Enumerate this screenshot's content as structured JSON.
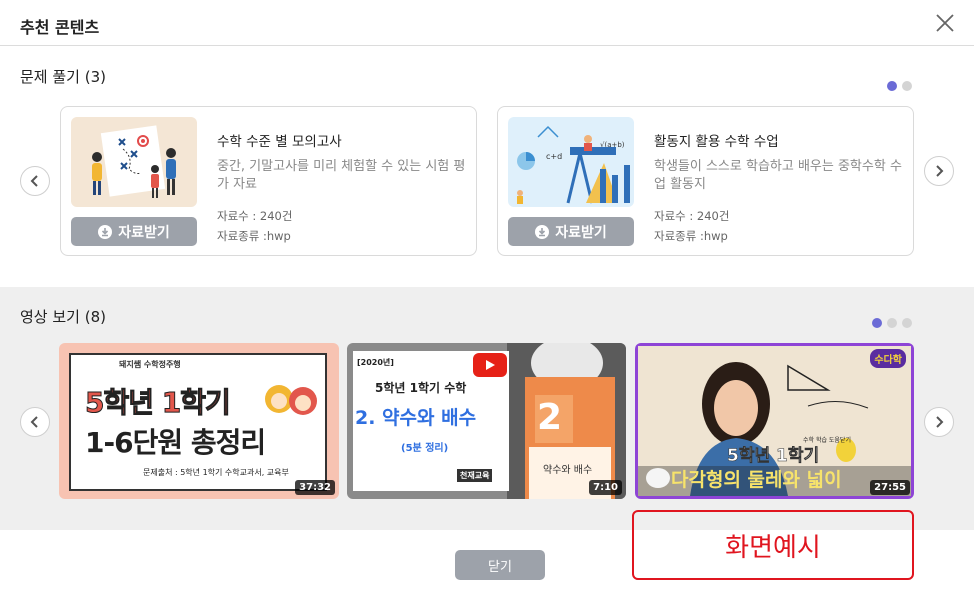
{
  "dialog": {
    "title": "추천 콘텐츠"
  },
  "problems": {
    "heading": "문제 풀기 (3)",
    "cards": [
      {
        "title": "수학 수준 별 모의고사",
        "desc": "중간, 기말고사를 미리 체험할 수 있는 시험 평가 자료",
        "count": "자료수 : 240건",
        "type": "자료종류 :hwp",
        "button": "자료받기"
      },
      {
        "title": "활동지 활용 수학 수업",
        "desc": "학생들이 스스로 학습하고 배우는 중학수학 수업 활동지",
        "count": "자료수 : 240건",
        "type": "자료종류 :hwp",
        "button": "자료받기"
      }
    ]
  },
  "videos": {
    "heading": "영상 보기 (8)",
    "items": [
      {
        "tag": "돼지쌤 수학정주행",
        "line1": "5학년 1학기",
        "line2": "1-6단원 총정리",
        "source": "문제출처 : 5학년 1학기 수학교과서, 교육부",
        "duration": "37:32"
      },
      {
        "tag": "[2020년]",
        "line1": "5학년 1학기 수학",
        "line2": "2. 약수와 배수",
        "line3": "(5분 정리)",
        "badge": "천재교육",
        "book_num": "2",
        "book_title": "약수와 배수",
        "duration": "7:10"
      },
      {
        "logo": "수다학",
        "caption_small": "수학 학습 도움닫기",
        "line1": "5학년 1학기",
        "line2": "다각형의 둘레와 넓이",
        "duration": "27:55"
      }
    ]
  },
  "footer": {
    "close": "닫기"
  },
  "annotation": {
    "label": "화면예시"
  },
  "colors": {
    "accent": "#6b6bd6",
    "button_gray": "#9da2aa",
    "annotation_red": "#e0151f"
  }
}
